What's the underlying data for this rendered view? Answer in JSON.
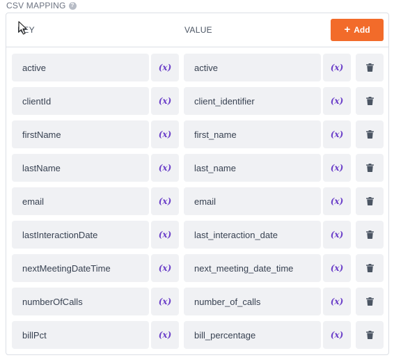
{
  "section": {
    "title": "CSV MAPPING",
    "help_icon": "question-circle-icon"
  },
  "header": {
    "key_label": "KEY",
    "value_label": "VALUE",
    "add_label": "Add",
    "add_icon": "plus-icon"
  },
  "colors": {
    "accent": "#f26b2a",
    "variable_icon": "#6b3fc9",
    "field_background": "#f0f1f4"
  },
  "variable_icon_text": "(x)",
  "rows": [
    {
      "key": "active",
      "value": "active"
    },
    {
      "key": "clientId",
      "value": "client_identifier"
    },
    {
      "key": "firstName",
      "value": "first_name"
    },
    {
      "key": "lastName",
      "value": "last_name"
    },
    {
      "key": "email",
      "value": "email"
    },
    {
      "key": "lastInteractionDate",
      "value": "last_interaction_date"
    },
    {
      "key": "nextMeetingDateTime",
      "value": "next_meeting_date_time"
    },
    {
      "key": "numberOfCalls",
      "value": "number_of_calls"
    },
    {
      "key": "billPct",
      "value": "bill_percentage"
    }
  ]
}
